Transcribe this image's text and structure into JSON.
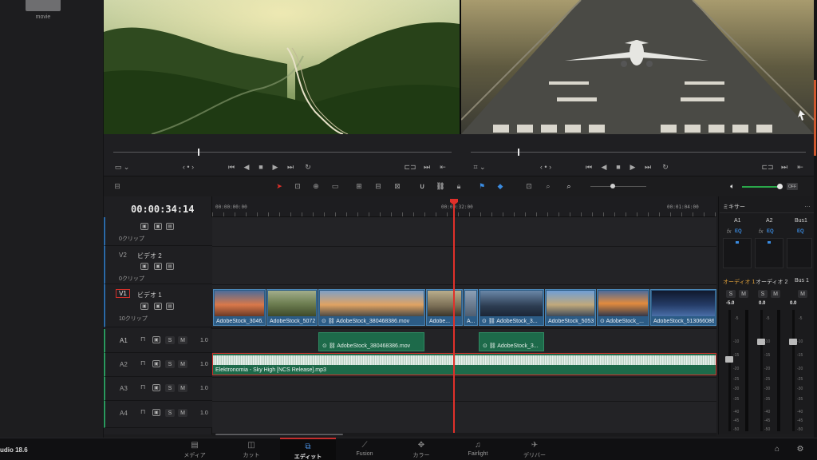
{
  "media_pool": {
    "thumb_label": "movie"
  },
  "timecode": "00:00:34:14",
  "ruler": {
    "t0": "00:00:00:00",
    "t1": "00:00:32:00",
    "t2": "00:01:04:00"
  },
  "tracks": {
    "v2": {
      "id": "V2",
      "name": "ビデオ 2",
      "clips": "0クリップ"
    },
    "v3_clips": "0クリップ",
    "v1": {
      "id": "V1",
      "name": "ビデオ 1",
      "clips": "10クリップ"
    },
    "a1": {
      "id": "A1",
      "vol": "1.0"
    },
    "a2": {
      "id": "A2",
      "vol": "1.0"
    },
    "a3": {
      "id": "A3",
      "vol": "1.0"
    },
    "a4": {
      "id": "A4",
      "vol": "1.0"
    },
    "s_label": "S",
    "m_label": "M"
  },
  "video_clips": [
    "AdobeStock_3046...",
    "AdobeStock_5072...",
    "AdobeStock_380468386.mov",
    "Adobe...",
    "A...",
    "AdobeStock_3...",
    "AdobeStock_5053...",
    "AdobeStock_...",
    "AdobeStock_513066086..."
  ],
  "audio_clips": {
    "a1_clip1": "AdobeStock_380468386.mov",
    "a1_clip2": "AdobeStock_3...",
    "a2_music": "Elektronomia - Sky High [NCS Release].mp3"
  },
  "mixer": {
    "title": "ミキサー",
    "cols": [
      "A1",
      "A2",
      "Bus1"
    ],
    "fx": "fx",
    "eq": "EQ",
    "channels": [
      "オーディオ 1",
      "オーディオ 2",
      "Bus 1"
    ],
    "levels": [
      "-5.0",
      "0.0",
      "0.0"
    ],
    "scale": [
      "-5",
      "-10",
      "-15",
      "-20",
      "-25",
      "-30",
      "-35",
      "-40",
      "-45",
      "-50"
    ]
  },
  "volume_box": "OFF",
  "app_version": "udio 18.6",
  "bottom_tabs": [
    "メディア",
    "カット",
    "エディット",
    "Fusion",
    "カラー",
    "Fairlight",
    "デリバー"
  ],
  "colors": {
    "accent_red": "#e0302a",
    "clip_blue": "#2c5c86",
    "clip_green": "#1d6a4a",
    "active_tab": "#c42d2d"
  }
}
